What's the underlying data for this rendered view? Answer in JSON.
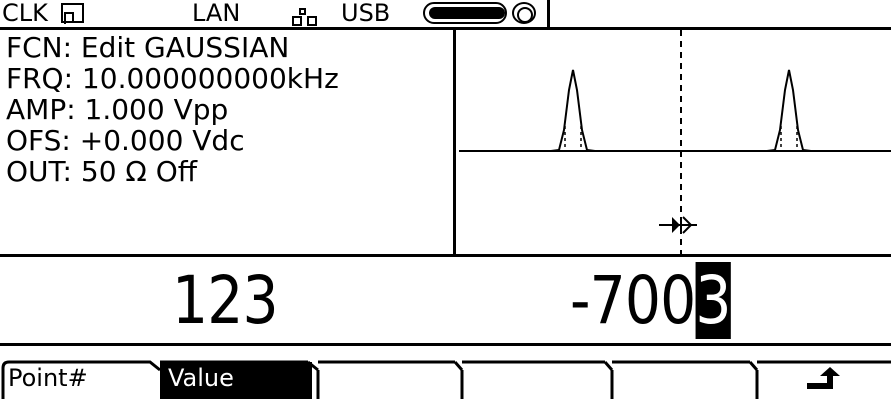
{
  "status_bar": {
    "clk_label": "CLK",
    "lan_label": "LAN",
    "usb_label": "USB",
    "icons": [
      "clock-square-wave-icon",
      "lan-network-icon",
      "usb-connector-icon",
      "record-indicator-icon"
    ]
  },
  "params": {
    "fcn": "FCN: Edit GAUSSIAN",
    "frq": "FRQ: 10.000000000kHz",
    "amp": "AMP: 1.000 Vpp",
    "ofs": "OFS: +0.000 Vdc",
    "out": "OUT: 50 Ω Off"
  },
  "edit": {
    "point_number": "123",
    "value_prefix": "-700",
    "value_cursor_digit": "3"
  },
  "softkeys": [
    {
      "label": "Point#",
      "selected": false
    },
    {
      "label": "Value",
      "selected": true
    },
    {
      "label": "",
      "selected": false
    },
    {
      "label": "",
      "selected": false
    },
    {
      "label": "",
      "selected": false
    },
    {
      "label": "",
      "selected": false,
      "icon": "return-arrow-icon"
    }
  ],
  "colors": {
    "foreground": "#000000",
    "background": "#ffffff"
  }
}
